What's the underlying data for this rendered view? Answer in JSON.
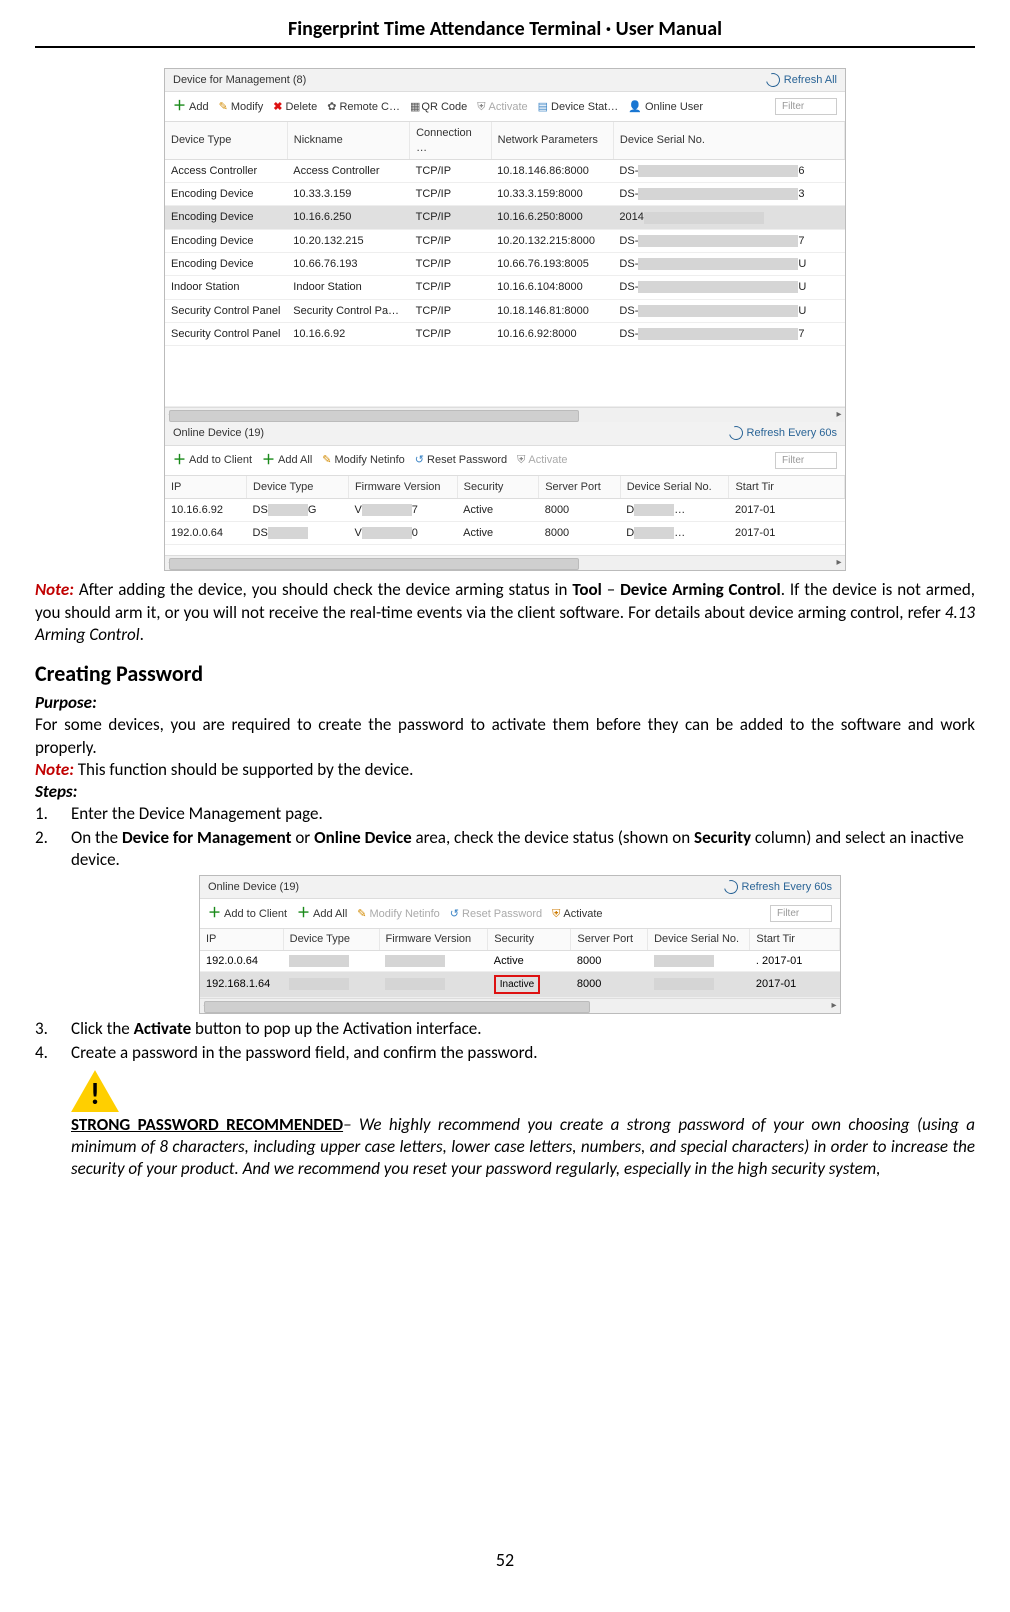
{
  "doc": {
    "header_title": "Fingerprint Time Attendance Terminal · User Manual",
    "page_number": "52"
  },
  "shot1": {
    "dfm_title": "Device for Management (8)",
    "refresh_all": "Refresh All",
    "tb": {
      "add": "Add",
      "modify": "Modify",
      "delete": "Delete",
      "remote": "Remote C…",
      "qr": "QR Code",
      "activate": "Activate",
      "devstat": "Device Stat…",
      "online_user": "Online User",
      "filter": "Filter"
    },
    "cols": {
      "dtype": "Device Type",
      "nick": "Nickname",
      "conn": "Connection …",
      "net": "Network Parameters",
      "serial": "Device Serial No."
    },
    "rows": [
      {
        "dtype": "Access Controller",
        "nick": "Access Controller",
        "conn": "TCP/IP",
        "net": "10.18.146.86:8000",
        "serial_pre": "DS-",
        "serial_suf": "6"
      },
      {
        "dtype": "Encoding Device",
        "nick": "10.33.3.159",
        "conn": "TCP/IP",
        "net": "10.33.3.159:8000",
        "serial_pre": "DS-",
        "serial_suf": "3"
      },
      {
        "dtype": "Encoding Device",
        "nick": "10.16.6.250",
        "conn": "TCP/IP",
        "net": "10.16.6.250:8000",
        "serial_pre": "2014",
        "serial_suf": ""
      },
      {
        "dtype": "Encoding Device",
        "nick": "10.20.132.215",
        "conn": "TCP/IP",
        "net": "10.20.132.215:8000",
        "serial_pre": "DS-",
        "serial_suf": "7"
      },
      {
        "dtype": "Encoding Device",
        "nick": "10.66.76.193",
        "conn": "TCP/IP",
        "net": "10.66.76.193:8005",
        "serial_pre": "DS-",
        "serial_suf": "U"
      },
      {
        "dtype": "Indoor Station",
        "nick": "Indoor Station",
        "conn": "TCP/IP",
        "net": "10.16.6.104:8000",
        "serial_pre": "DS-",
        "serial_suf": "U"
      },
      {
        "dtype": "Security Control Panel",
        "nick": "Security Control Pa…",
        "conn": "TCP/IP",
        "net": "10.18.146.81:8000",
        "serial_pre": "DS-",
        "serial_suf": "U"
      },
      {
        "dtype": "Security Control Panel",
        "nick": "10.16.6.92",
        "conn": "TCP/IP",
        "net": "10.16.6.92:8000",
        "serial_pre": "DS-",
        "serial_suf": "7"
      }
    ],
    "online_title": "Online Device (19)",
    "refresh60": "Refresh Every 60s",
    "tb2": {
      "addclient": "Add to Client",
      "addall": "Add All",
      "modnet": "Modify Netinfo",
      "resetpw": "Reset Password",
      "activate": "Activate",
      "filter": "Filter"
    },
    "online_cols": {
      "ip": "IP",
      "dtype": "Device Type",
      "fw": "Firmware Version",
      "sec": "Security",
      "port": "Server Port",
      "serial": "Device Serial No.",
      "start": "Start Tir"
    },
    "online_rows": [
      {
        "ip": "10.16.6.92",
        "dtype_pre": "DS",
        "dtype_suf": "G",
        "fw_pre": "V",
        "fw_suf": "7",
        "sec": "Active",
        "port": "8000",
        "serial_pre": "D",
        "serial_suf": "…",
        "start": "2017-01"
      },
      {
        "ip": "192.0.0.64",
        "dtype_pre": "DS",
        "dtype_suf": "",
        "fw_pre": "V",
        "fw_suf": "0",
        "sec": "Active",
        "port": "8000",
        "serial_pre": "D",
        "serial_suf": "…",
        "start": "2017-01"
      }
    ]
  },
  "note1": {
    "label": "Note:",
    "p1a": " After adding the device, you should check the device arming status in ",
    "tool": "Tool",
    "dash": " – ",
    "dac": "Device Arming Control",
    "p1b": ". If the device is not armed, you should arm it, or you will not receive the real-time events via the client software. For details about device arming control, refer ",
    "ref": "4.13 Arming Control",
    "dot": "."
  },
  "cp": {
    "heading": "Creating Password",
    "purpose_lbl": "Purpose:",
    "purpose_txt": "For some devices, you are required to create the password to activate them before they can be added to the software and work properly.",
    "note_lbl": "Note:",
    "note_txt": " This function should be supported by the device.",
    "steps_lbl": "Steps:",
    "s1": "Enter the Device Management page.",
    "s2a": "On the ",
    "s2b": "Device for Management",
    "s2c": " or ",
    "s2d": "Online Device",
    "s2e": " area, check the device status (shown on ",
    "s2f": "Security",
    "s2g": " column) and select an inactive device.",
    "s3a": "Click the ",
    "s3b": "Activate",
    "s3c": " button to pop up the Activation interface.",
    "s4": "Create a password in the password field, and confirm the password."
  },
  "shot2": {
    "title": "Online Device (19)",
    "refresh": "Refresh Every 60s",
    "tb": {
      "addclient": "Add to Client",
      "addall": "Add All",
      "modnet": "Modify Netinfo",
      "resetpw": "Reset Password",
      "activate": "Activate",
      "filter": "Filter"
    },
    "cols": {
      "ip": "IP",
      "dtype": "Device Type",
      "fw": "Firmware Version",
      "sec": "Security",
      "port": "Server Port",
      "serial": "Device Serial No.",
      "start": "Start Tir"
    },
    "rows": [
      {
        "ip": "192.0.0.64",
        "sec": "Active",
        "port": "8000",
        "start": ". 2017-01"
      },
      {
        "ip": "192.168.1.64",
        "sec": "Inactive",
        "port": "8000",
        "start": "2017-01"
      }
    ]
  },
  "pw": {
    "title": "STRONG PASSWORD RECOMMENDED",
    "dash": "– ",
    "body": "We highly recommend you create a strong password of your own choosing (using a minimum of 8 characters, including upper case letters, lower case letters, numbers, and special characters) in order to increase the security of your product. And we recommend you reset your password regularly, especially in the high security system,"
  }
}
